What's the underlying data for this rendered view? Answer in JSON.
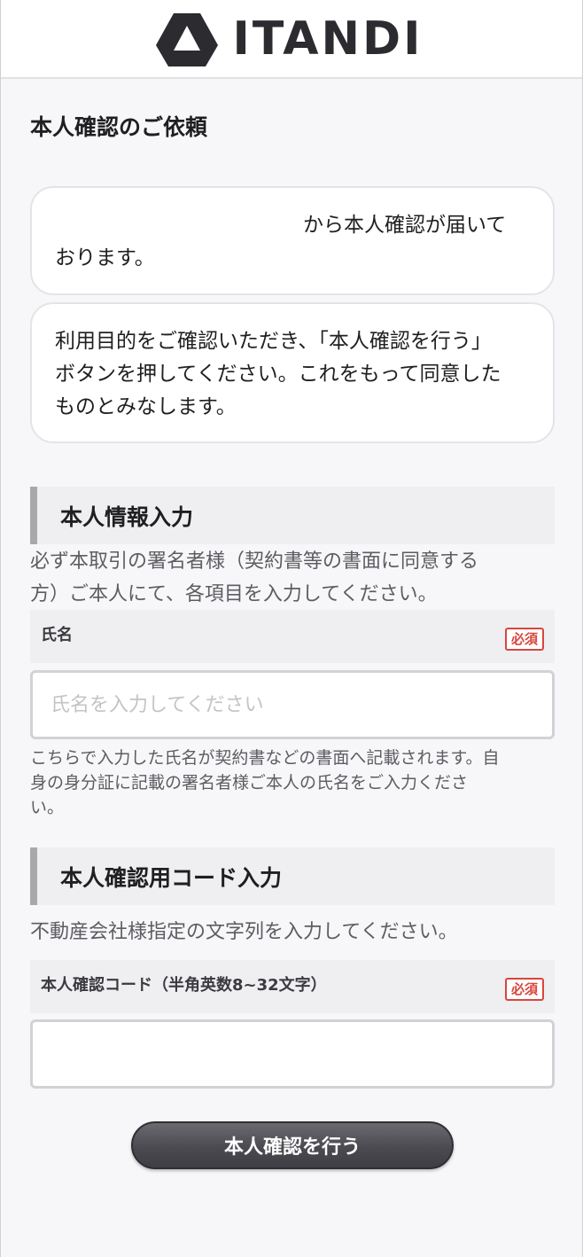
{
  "header": {
    "logo_text": "ITANDI",
    "logo_icon": "itandi-triangle-icon"
  },
  "page": {
    "title": "本人確認のご依頼"
  },
  "messages": {
    "request_text": "から本人確認が届いております。",
    "request_line1": "から本人確認が届いて",
    "request_line2": "おります。",
    "instruction_line1": "利用目的をご確認いただき、「本人確認を行う」",
    "instruction_line2": "ボタンを押してください。これをもって同意した",
    "instruction_line3": "ものとみなします。"
  },
  "personal_info": {
    "heading": "本人情報入力",
    "note_line1": "必ず本取引の署名者様（契約書等の書面に同意する",
    "note_line2": "方）ご本人にて、各項目を入力してください。",
    "name_label": "氏名",
    "required_badge": "必須",
    "name_placeholder": "氏名を入力してください",
    "name_value": "",
    "name_hint_line1": "こちらで入力した氏名が契約書などの書面へ記載されます。自",
    "name_hint_line2": "身の身分証に記載の署名者様ご本人の氏名をご入力くださ",
    "name_hint_line3": "い。"
  },
  "code_section": {
    "heading": "本人確認用コード入力",
    "note": "不動産会社様指定の文字列を入力してください。",
    "code_label": "本人確認コード（半角英数8~32文字）",
    "required_badge": "必須",
    "code_value": ""
  },
  "actions": {
    "submit_label": "本人確認を行う"
  },
  "colors": {
    "required": "#d9463c",
    "button": "#4a4a50",
    "section_bar": "#a8a8ac"
  }
}
